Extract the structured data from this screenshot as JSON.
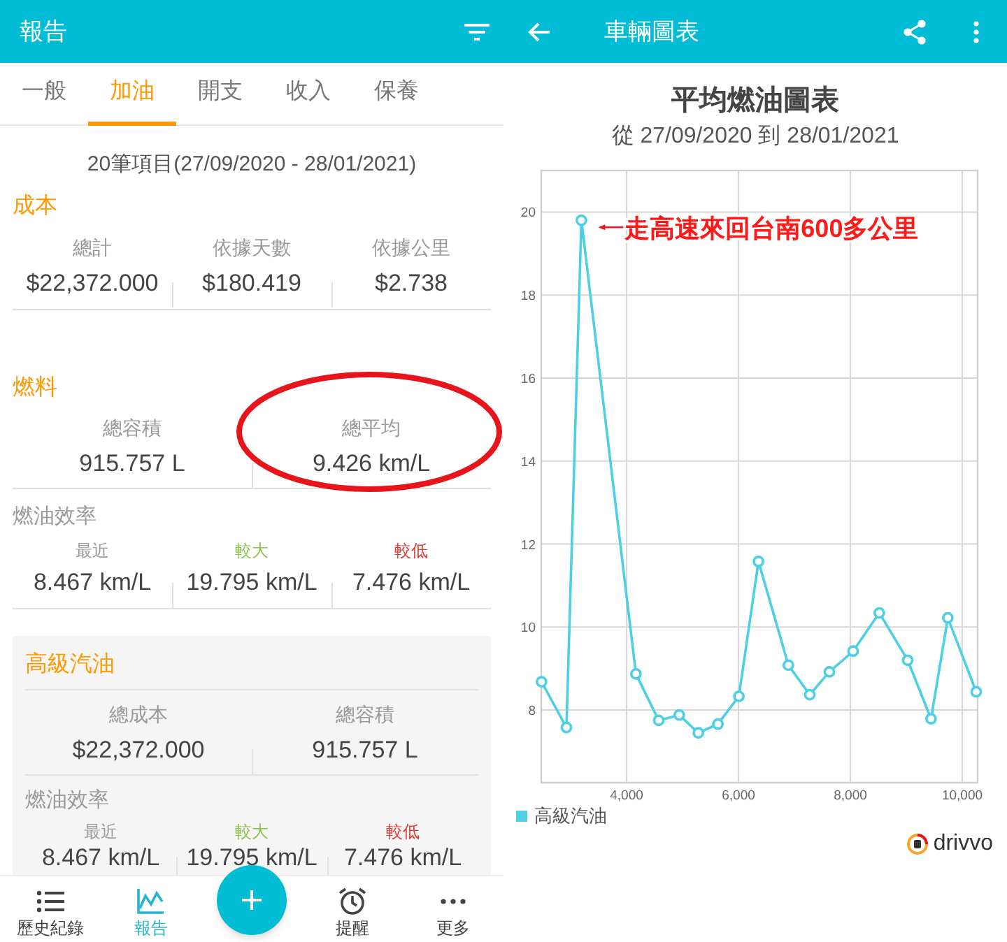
{
  "left": {
    "app_bar": {
      "title": "報告"
    },
    "tabs": [
      {
        "label": "一般",
        "selected": false
      },
      {
        "label": "加油",
        "selected": true
      },
      {
        "label": "開支",
        "selected": false
      },
      {
        "label": "收入",
        "selected": false
      },
      {
        "label": "保養",
        "selected": false
      }
    ],
    "summary": "20筆項目(27/09/2020 - 28/01/2021)",
    "cost": {
      "title": "成本",
      "stats": [
        {
          "label": "總計",
          "value": "$22,372.000"
        },
        {
          "label": "依據天數",
          "value": "$180.419"
        },
        {
          "label": "依據公里",
          "value": "$2.738"
        }
      ]
    },
    "fuel": {
      "title": "燃料",
      "stats": [
        {
          "label": "總容積",
          "value": "915.757 L",
          "circled": false
        },
        {
          "label": "總平均",
          "value": "9.426 km/L",
          "circled": true
        }
      ],
      "efficiency": {
        "title": "燃油效率",
        "items": [
          {
            "kind": "recent",
            "label": "最近",
            "value": "8.467 km/L"
          },
          {
            "kind": "max",
            "label": "較大",
            "value": "19.795 km/L"
          },
          {
            "kind": "min",
            "label": "較低",
            "value": "7.476 km/L"
          }
        ]
      }
    },
    "fuel_types": [
      {
        "title": "高級汽油",
        "stats": [
          {
            "label": "總成本",
            "value": "$22,372.000"
          },
          {
            "label": "總容積",
            "value": "915.757 L"
          }
        ],
        "efficiency": {
          "title": "燃油效率",
          "items": [
            {
              "kind": "recent",
              "label": "最近",
              "value": "8.467 km/L"
            },
            {
              "kind": "max",
              "label": "較大",
              "value": "19.795 km/L"
            },
            {
              "kind": "min",
              "label": "較低",
              "value": "7.476 km/L"
            }
          ]
        }
      }
    ],
    "bottom_nav": [
      {
        "kind": "history",
        "label": "歷史紀錄",
        "selected": false
      },
      {
        "kind": "report",
        "label": "報告",
        "selected": true
      },
      {
        "kind": "add"
      },
      {
        "kind": "reminder",
        "label": "提醒",
        "selected": false
      },
      {
        "kind": "more",
        "label": "更多",
        "selected": false
      }
    ]
  },
  "right": {
    "app_bar": {
      "title": "車輛圖表"
    },
    "title": "平均燃油圖表",
    "subtitle": "從 27/09/2020 到 28/01/2021",
    "chart_data": {
      "type": "line",
      "x": [
        2480,
        2925,
        3192,
        4167,
        4575,
        4942,
        5283,
        5633,
        6008,
        6358,
        6892,
        7275,
        7625,
        8050,
        8517,
        9025,
        9442,
        9742,
        10250
      ],
      "grid": true,
      "series": [
        {
          "name": "高級汽油",
          "color": "#4dd0e1",
          "marker": "circle",
          "values": [
            8.68,
            7.58,
            19.8,
            8.87,
            7.75,
            7.88,
            7.45,
            7.66,
            8.33,
            11.58,
            9.08,
            8.37,
            8.92,
            9.42,
            10.34,
            9.2,
            7.79,
            10.22,
            8.44
          ]
        }
      ],
      "xlim": [
        2475,
        10275
      ],
      "ylim": [
        6.25,
        21
      ],
      "xticks": [
        {
          "value": 4000,
          "label": "4,000"
        },
        {
          "value": 6000,
          "label": "6,000"
        },
        {
          "value": 8000,
          "label": "8,000"
        },
        {
          "value": 10000,
          "label": "10,000"
        }
      ],
      "yticks": [
        8,
        10,
        12,
        14,
        16,
        18,
        20
      ],
      "annotations": [
        {
          "text": "走高速來回台南600多公里",
          "x": 3192,
          "y": 19.8
        }
      ]
    },
    "branding": "drivvo"
  }
}
